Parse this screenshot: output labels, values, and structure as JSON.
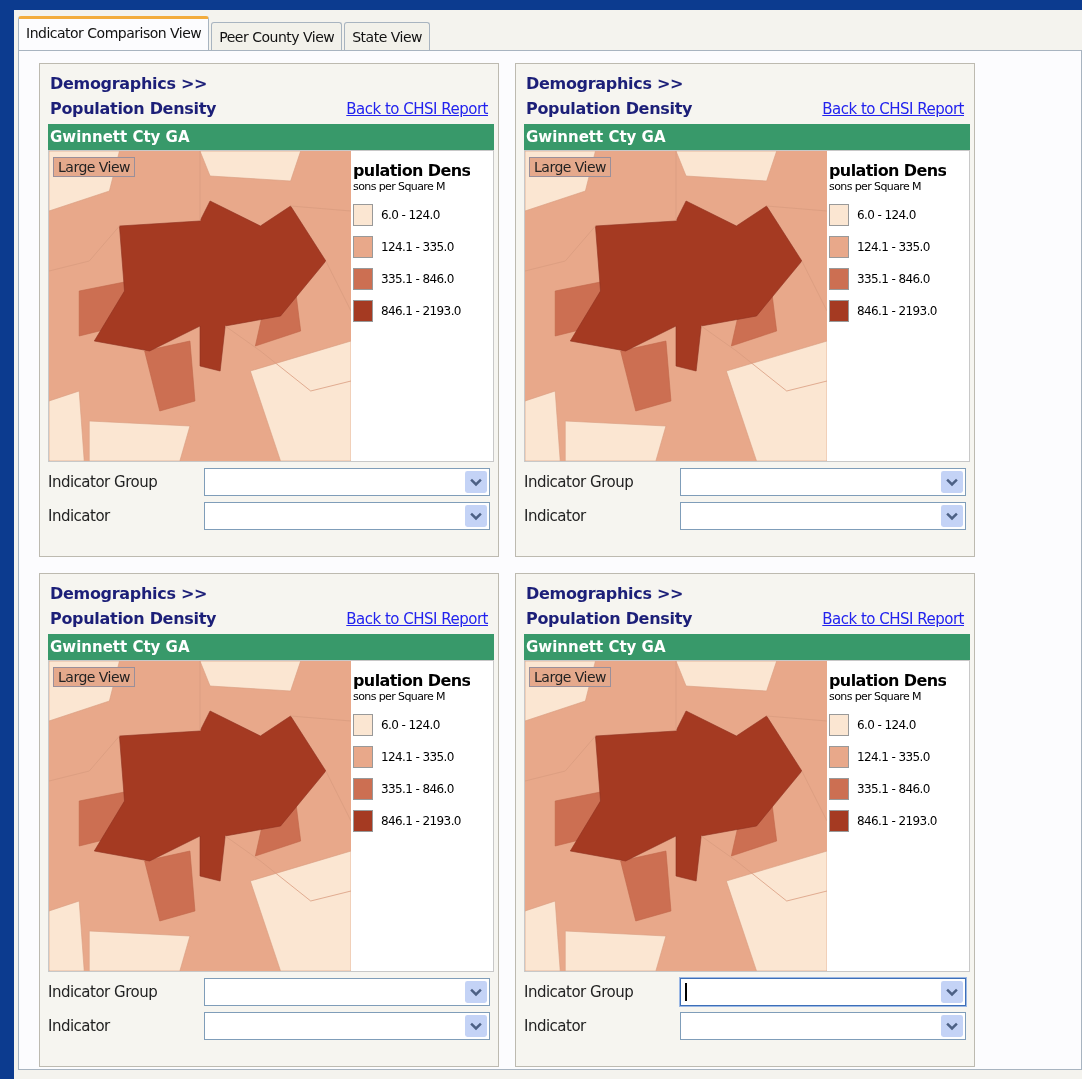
{
  "tabs": [
    {
      "label": "Indicator Comparison View",
      "selected": true
    },
    {
      "label": "Peer County View",
      "selected": false
    },
    {
      "label": "State View",
      "selected": false
    }
  ],
  "panels": [
    {
      "breadcrumb": "Demographics >>",
      "title": "Population Density",
      "link": "Back to CHSI Report",
      "county": "Gwinnett Cty GA",
      "large_view": "Large View",
      "legend": {
        "title": "pulation Dens",
        "subtitle": "sons per Square M",
        "items": [
          {
            "label": "6.0 - 124.0",
            "color": "#fbe6d2"
          },
          {
            "label": "124.1 - 335.0",
            "color": "#e8a88a"
          },
          {
            "label": "335.1 - 846.0",
            "color": "#cc6f52"
          },
          {
            "label": "846.1 - 2193.0",
            "color": "#a53a22"
          }
        ]
      },
      "fields": [
        {
          "label": "Indicator Group",
          "focused": false
        },
        {
          "label": "Indicator",
          "focused": false
        }
      ]
    },
    {
      "breadcrumb": "Demographics >>",
      "title": "Population Density",
      "link": "Back to CHSI Report",
      "county": "Gwinnett Cty GA",
      "large_view": "Large View",
      "legend": {
        "title": "pulation Dens",
        "subtitle": "sons per Square M",
        "items": [
          {
            "label": "6.0 - 124.0",
            "color": "#fbe6d2"
          },
          {
            "label": "124.1 - 335.0",
            "color": "#e8a88a"
          },
          {
            "label": "335.1 - 846.0",
            "color": "#cc6f52"
          },
          {
            "label": "846.1 - 2193.0",
            "color": "#a53a22"
          }
        ]
      },
      "fields": [
        {
          "label": "Indicator Group",
          "focused": false
        },
        {
          "label": "Indicator",
          "focused": false
        }
      ]
    },
    {
      "breadcrumb": "Demographics >>",
      "title": "Population Density",
      "link": "Back to CHSI Report",
      "county": "Gwinnett Cty GA",
      "large_view": "Large View",
      "legend": {
        "title": "pulation Dens",
        "subtitle": "sons per Square M",
        "items": [
          {
            "label": "6.0 - 124.0",
            "color": "#fbe6d2"
          },
          {
            "label": "124.1 - 335.0",
            "color": "#e8a88a"
          },
          {
            "label": "335.1 - 846.0",
            "color": "#cc6f52"
          },
          {
            "label": "846.1 - 2193.0",
            "color": "#a53a22"
          }
        ]
      },
      "fields": [
        {
          "label": "Indicator Group",
          "focused": false
        },
        {
          "label": "Indicator",
          "focused": false
        }
      ]
    },
    {
      "breadcrumb": "Demographics >>",
      "title": "Population Density",
      "link": "Back to CHSI Report",
      "county": "Gwinnett Cty GA",
      "large_view": "Large View",
      "legend": {
        "title": "pulation Dens",
        "subtitle": "sons per Square M",
        "items": [
          {
            "label": "6.0 - 124.0",
            "color": "#fbe6d2"
          },
          {
            "label": "124.1 - 335.0",
            "color": "#e8a88a"
          },
          {
            "label": "335.1 - 846.0",
            "color": "#cc6f52"
          },
          {
            "label": "846.1 - 2193.0",
            "color": "#a53a22"
          }
        ]
      },
      "fields": [
        {
          "label": "Indicator Group",
          "focused": true
        },
        {
          "label": "Indicator",
          "focused": false
        }
      ]
    }
  ]
}
